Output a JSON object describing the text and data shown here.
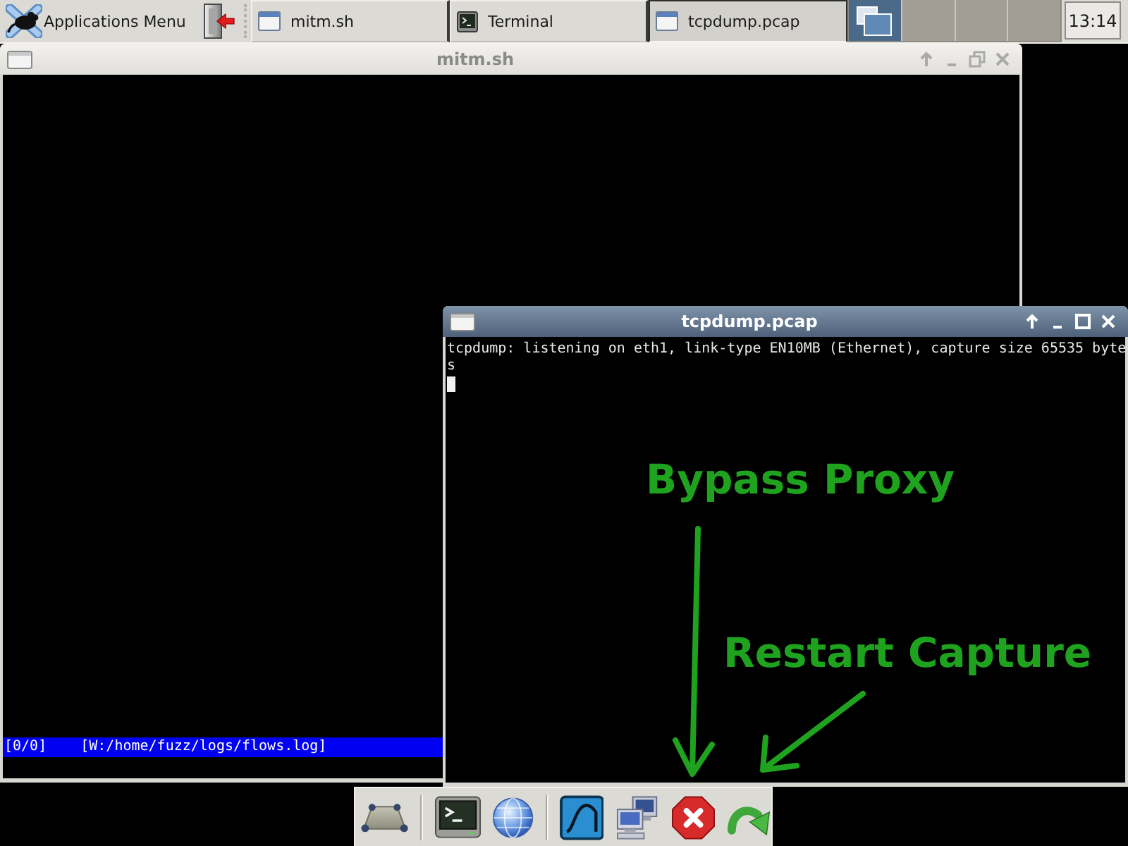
{
  "top_panel": {
    "app_menu": {
      "label": "Applications Menu"
    },
    "tasks": [
      {
        "label": "mitm.sh",
        "kind": "window",
        "selected": false
      },
      {
        "label": "Terminal",
        "kind": "terminal",
        "selected": false
      },
      {
        "label": "tcpdump.pcap",
        "kind": "window",
        "selected": true
      }
    ],
    "workspaces": [
      {
        "selected": true
      },
      {
        "selected": false
      },
      {
        "selected": false
      },
      {
        "selected": false
      }
    ],
    "clock": "13:14"
  },
  "windows": [
    {
      "title": "mitm.sh",
      "active": false,
      "maximized": true,
      "status_line": [
        "[0/0]",
        "[W:/home/fuzz/logs/flows.log]"
      ]
    },
    {
      "title": "tcpdump.pcap",
      "active": true,
      "maximized": false,
      "lines": [
        "tcpdump: listening on eth1, link-type EN10MB (Ethernet), capture size 65535 byte",
        "s"
      ],
      "cursor": true
    }
  ],
  "dock": {
    "items": [
      {
        "kind": "desktop"
      },
      {
        "kind": "separator"
      },
      {
        "kind": "terminal"
      },
      {
        "kind": "browser"
      },
      {
        "kind": "separator"
      },
      {
        "kind": "capture"
      },
      {
        "kind": "network"
      },
      {
        "kind": "stop"
      },
      {
        "kind": "reload"
      }
    ]
  },
  "annotations": [
    {
      "label": "Bypass Proxy"
    },
    {
      "label": "Restart Capture"
    }
  ]
}
